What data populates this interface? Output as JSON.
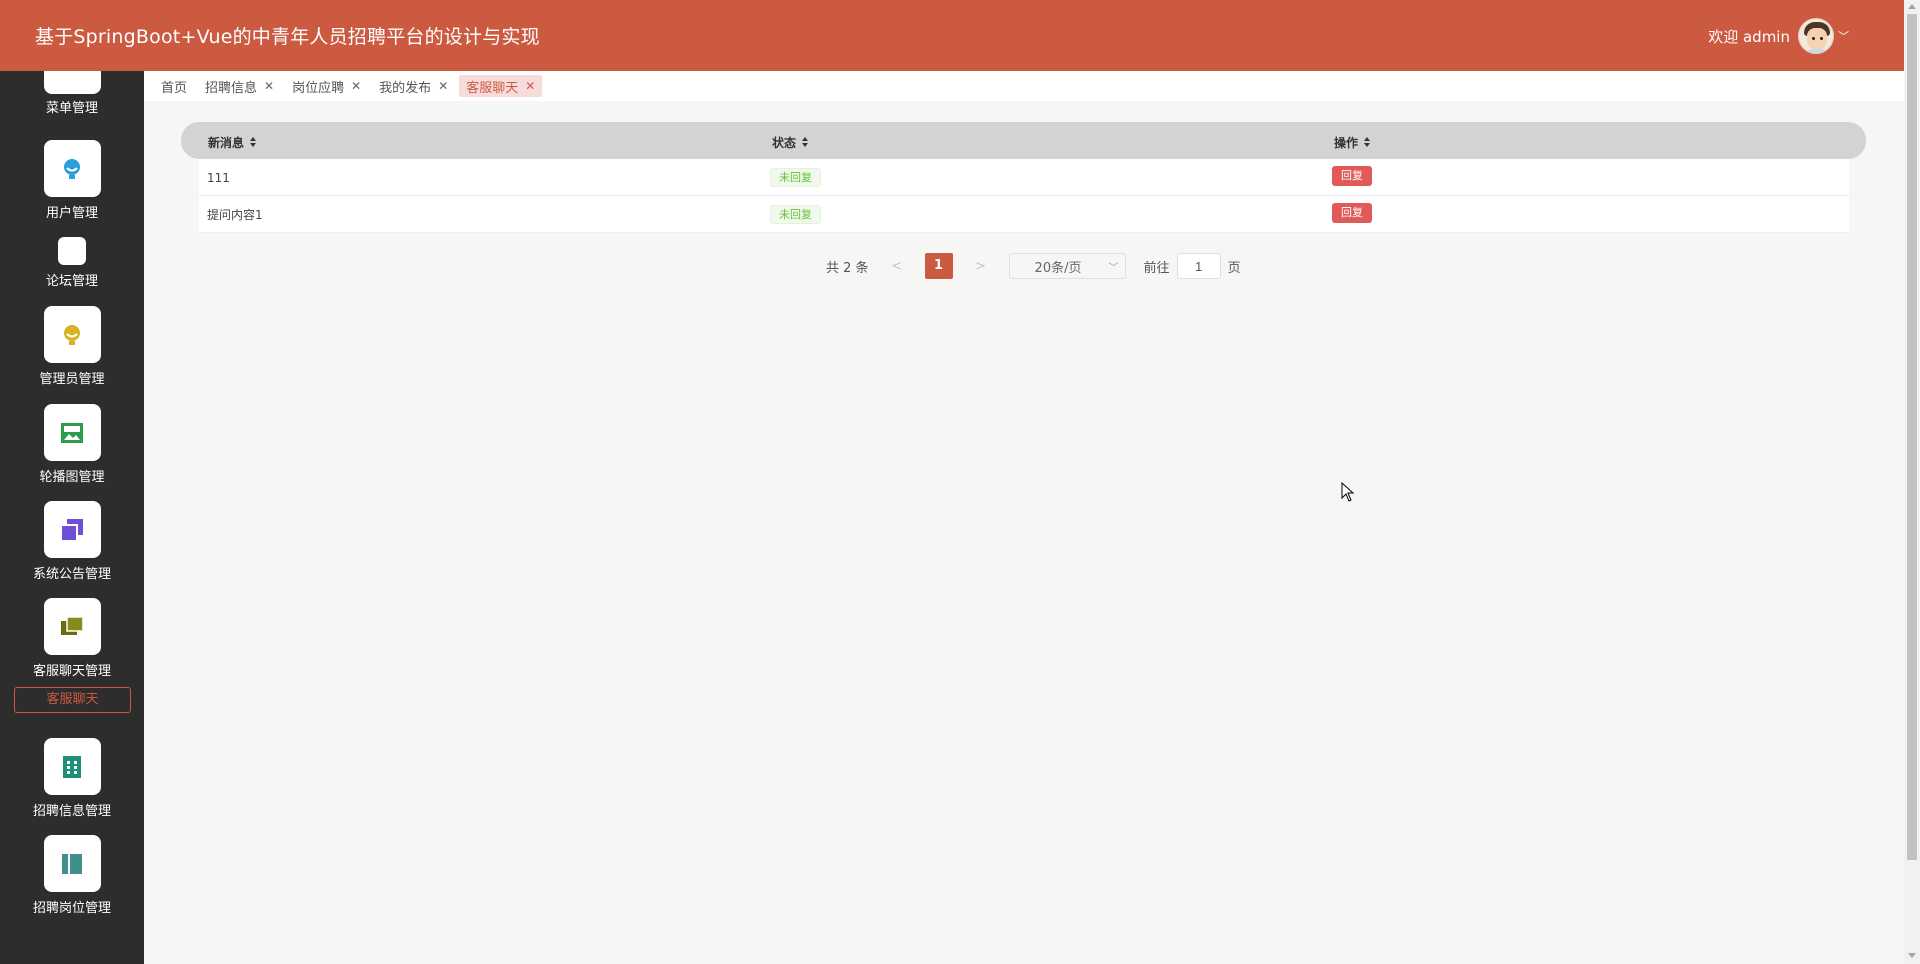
{
  "app": {
    "title": "基于SpringBoot+Vue的中青年人员招聘平台的设计与实现",
    "welcome": "欢迎 admin"
  },
  "sidebar": {
    "items": [
      {
        "label": "菜单管理",
        "icon": "menu-icon",
        "color": "#1e8bd1"
      },
      {
        "label": "用户管理",
        "icon": "user-icon",
        "color": "#2b9fd9"
      },
      {
        "label": "论坛管理",
        "icon": "forum-icon",
        "color": "#aaaaaa"
      },
      {
        "label": "管理员管理",
        "icon": "admin-icon",
        "color": "#d6b320"
      },
      {
        "label": "轮播图管理",
        "icon": "carousel-icon",
        "color": "#2e9b4e"
      },
      {
        "label": "系统公告管理",
        "icon": "notice-icon",
        "color": "#6f4fd8"
      },
      {
        "label": "客服聊天管理",
        "icon": "chat-icon",
        "color": "#8a8a1a"
      },
      {
        "label": "客服聊天",
        "icon": "",
        "color": "#cc5a41"
      },
      {
        "label": "招聘信息管理",
        "icon": "recruit-icon",
        "color": "#1f8f7a"
      },
      {
        "label": "招聘岗位管理",
        "icon": "position-icon",
        "color": "#3f8f8f"
      }
    ]
  },
  "tabs": [
    {
      "label": "首页",
      "closable": false
    },
    {
      "label": "招聘信息",
      "closable": true
    },
    {
      "label": "岗位应聘",
      "closable": true
    },
    {
      "label": "我的发布",
      "closable": true
    },
    {
      "label": "客服聊天",
      "closable": true,
      "active": true
    }
  ],
  "table": {
    "columns": [
      "新消息",
      "状态",
      "操作"
    ],
    "rows": [
      {
        "message": "111",
        "status": "未回复",
        "action": "回复"
      },
      {
        "message": "提问内容1",
        "status": "未回复",
        "action": "回复"
      }
    ]
  },
  "pagination": {
    "total": "共 2 条",
    "prev": "<",
    "current": "1",
    "next": ">",
    "page_size": "20条/页",
    "goto_label": "前往",
    "goto_value": "1",
    "page_suffix": "页"
  },
  "colors": {
    "header": "#cc5a41",
    "sidebar": "#2d2d2d",
    "accent": "#cc5a41",
    "reply_button": "#e05a5a",
    "status_green": "#67c23a"
  }
}
